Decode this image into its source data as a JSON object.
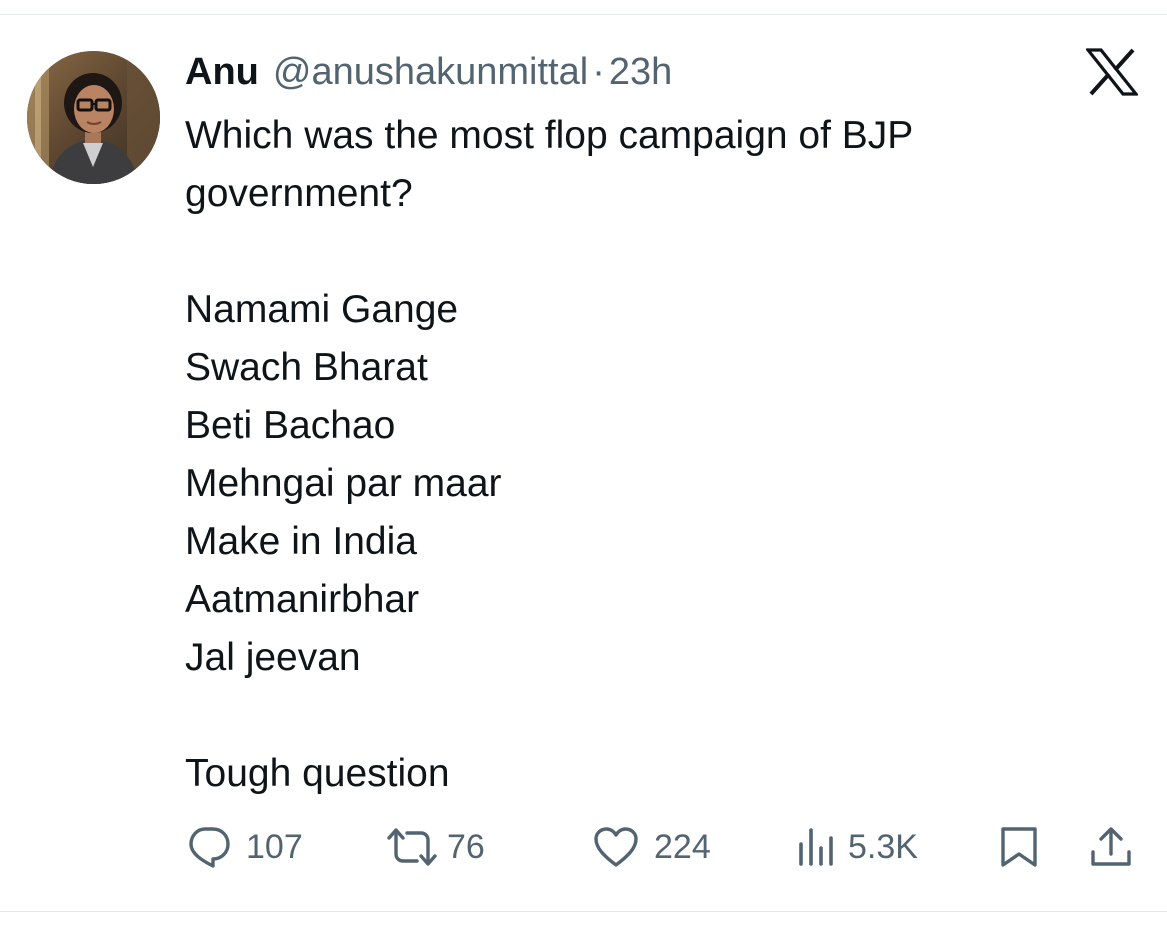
{
  "tweet": {
    "author_name": "Anu",
    "author_handle": "@anushakunmittal",
    "separator": "·",
    "timestamp": "23h",
    "platform_icon": "x-logo-icon",
    "text_lines": [
      "Which was the most flop campaign of BJP",
      "government?",
      "",
      "Namami Gange",
      "Swach Bharat",
      "Beti Bachao",
      "Mehngai par maar",
      "Make in India",
      "Aatmanirbhar",
      "Jal jeevan",
      "",
      "Tough question"
    ]
  },
  "actions": {
    "replies": {
      "icon": "reply-icon",
      "count": "107"
    },
    "reposts": {
      "icon": "repost-icon",
      "count": "76"
    },
    "likes": {
      "icon": "heart-icon",
      "count": "224"
    },
    "views": {
      "icon": "views-icon",
      "count": "5.3K"
    },
    "bookmark": {
      "icon": "bookmark-icon"
    },
    "share": {
      "icon": "share-icon"
    }
  },
  "colors": {
    "text_primary": "#0f1419",
    "text_secondary": "#536471",
    "divider": "#e6e9ec"
  }
}
